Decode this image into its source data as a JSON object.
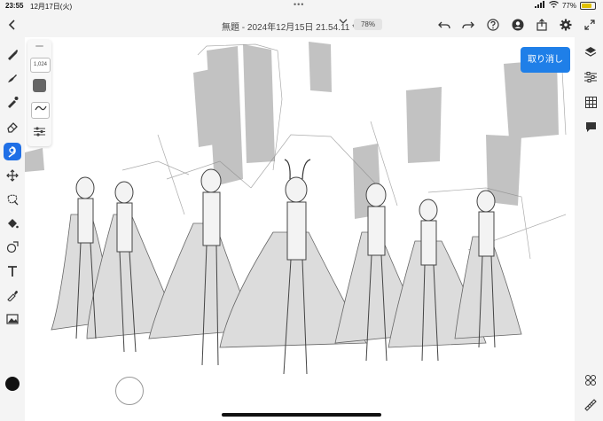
{
  "status": {
    "time": "23:55",
    "date": "12月17日(火)",
    "dots": "•••",
    "battery_pct": "77%",
    "battery_level": 0.77
  },
  "header": {
    "title": "無題 - 2024年12月15日 21.54.11 *",
    "zoom": "78%"
  },
  "brush_panel": {
    "size": "1,024"
  },
  "canvas": {
    "cancel_label": "取り消し"
  },
  "colors": {
    "accent": "#1f6fe6",
    "active_color": "#111111",
    "brush_color": "#666666"
  }
}
